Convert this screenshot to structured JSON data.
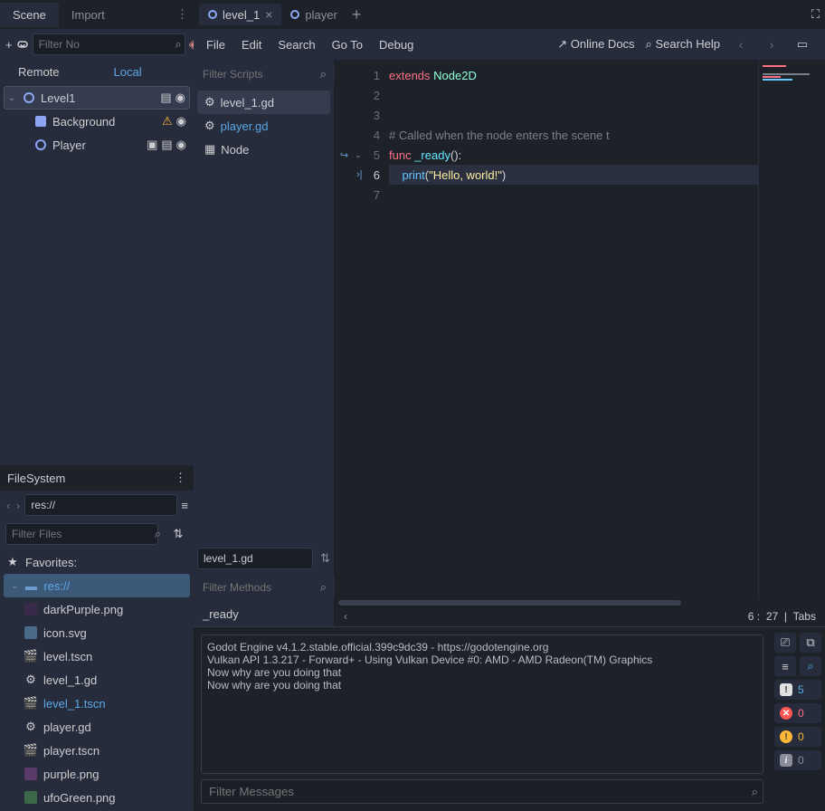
{
  "left_tabs": {
    "scene": "Scene",
    "import": "Import"
  },
  "scene": {
    "filter_placeholder": "Filter No",
    "remote": "Remote",
    "local": "Local",
    "nodes": [
      {
        "name": "Level1",
        "type": "Node2D",
        "selected": true
      },
      {
        "name": "Background",
        "type": "Sprite",
        "warn": true
      },
      {
        "name": "Player",
        "type": "Node2D",
        "instanced": true
      }
    ]
  },
  "filesystem": {
    "title": "FileSystem",
    "path": "res://",
    "filter_placeholder": "Filter Files",
    "favorites": "Favorites:",
    "root": "res://",
    "files": [
      {
        "name": "darkPurple.png",
        "type": "image",
        "color": "#3a2a4a"
      },
      {
        "name": "icon.svg",
        "type": "svg",
        "color": "#4a6a8a"
      },
      {
        "name": "level.tscn",
        "type": "scene"
      },
      {
        "name": "level_1.gd",
        "type": "script"
      },
      {
        "name": "level_1.tscn",
        "type": "scene",
        "link": true
      },
      {
        "name": "player.gd",
        "type": "script"
      },
      {
        "name": "player.tscn",
        "type": "scene"
      },
      {
        "name": "purple.png",
        "type": "image",
        "color": "#5a3a6a"
      },
      {
        "name": "ufoGreen.png",
        "type": "image",
        "color": "#3a6a4a"
      }
    ]
  },
  "editor_tabs": [
    {
      "name": "level_1",
      "active": true,
      "closable": true
    },
    {
      "name": "player",
      "active": false,
      "closable": false
    }
  ],
  "menu": {
    "items": [
      "File",
      "Edit",
      "Search",
      "Go To",
      "Debug"
    ],
    "online_docs": "Online Docs",
    "search_help": "Search Help"
  },
  "script_panel": {
    "filter_placeholder": "Filter Scripts",
    "items": [
      {
        "name": "level_1.gd",
        "icon": "gear",
        "selected": true
      },
      {
        "name": "player.gd",
        "icon": "gear",
        "link": true
      },
      {
        "name": "Node",
        "icon": "doc"
      }
    ],
    "current_script": "level_1.gd",
    "methods_placeholder": "Filter Methods",
    "methods": [
      "_ready"
    ]
  },
  "code": {
    "lines": [
      {
        "n": 1,
        "tokens": [
          [
            "kw-red",
            "extends"
          ],
          [
            "plain",
            " "
          ],
          [
            "kw-type",
            "Node2D"
          ]
        ]
      },
      {
        "n": 2,
        "tokens": []
      },
      {
        "n": 3,
        "tokens": []
      },
      {
        "n": 4,
        "tokens": [
          [
            "kw-comment",
            "# Called when the node enters the scene t"
          ]
        ]
      },
      {
        "n": 5,
        "tokens": [
          [
            "kw-red",
            "func"
          ],
          [
            "plain",
            " "
          ],
          [
            "kw-func",
            "_ready"
          ],
          [
            "kw-paren",
            "():"
          ]
        ],
        "gutter_conn": true,
        "fold": true
      },
      {
        "n": 6,
        "tokens": [
          [
            "plain",
            "    "
          ],
          [
            "kw-call",
            "print"
          ],
          [
            "kw-paren",
            "("
          ],
          [
            "kw-str",
            "\"Hello, world!\""
          ],
          [
            "kw-paren",
            ")"
          ]
        ],
        "current": true,
        "gutter_step": true
      },
      {
        "n": 7,
        "tokens": []
      }
    ]
  },
  "status": {
    "line": "6",
    "col": "27",
    "indent": "Tabs"
  },
  "output": {
    "lines": [
      "Godot Engine v4.1.2.stable.official.399c9dc39 - https://godotengine.org",
      "Vulkan API 1.3.217 - Forward+ - Using Vulkan Device #0: AMD - AMD Radeon(TM) Graphics",
      "",
      "Now why are you doing that",
      "Now why are you doing that"
    ],
    "filter_placeholder": "Filter Messages",
    "counts": {
      "msg": "5",
      "err": "0",
      "warn": "0",
      "info": "0"
    }
  }
}
